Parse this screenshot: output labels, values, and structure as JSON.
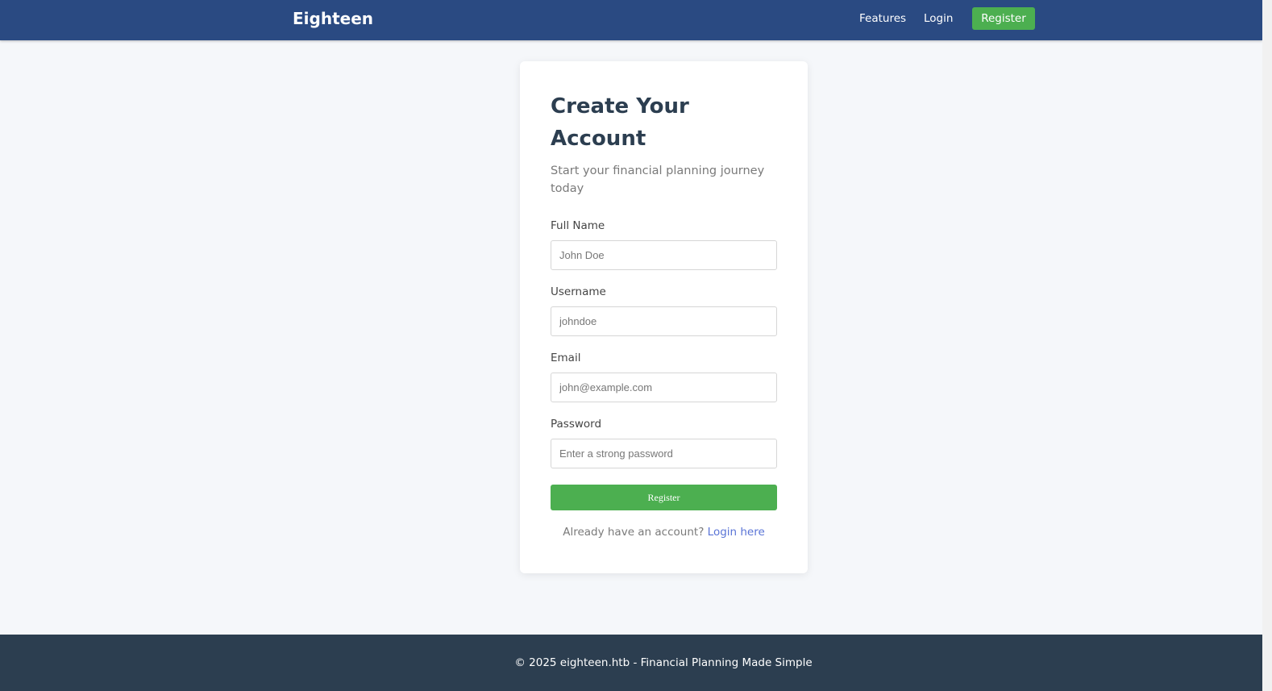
{
  "navbar": {
    "brand": "Eighteen",
    "links": {
      "features": "Features",
      "login": "Login",
      "register": "Register"
    }
  },
  "form": {
    "title": "Create Your Account",
    "subtitle": "Start your financial planning journey today",
    "fields": {
      "full_name": {
        "label": "Full Name",
        "placeholder": "John Doe",
        "value": ""
      },
      "username": {
        "label": "Username",
        "placeholder": "johndoe",
        "value": ""
      },
      "email": {
        "label": "Email",
        "placeholder": "john@example.com",
        "value": ""
      },
      "password": {
        "label": "Password",
        "placeholder": "Enter a strong password",
        "value": ""
      }
    },
    "submit_label": "Register",
    "login_prompt": "Already have an account?",
    "login_link": "Login here"
  },
  "footer": {
    "text": "© 2025 eighteen.htb - Financial Planning Made Simple"
  },
  "colors": {
    "navbar": "#2a4a82",
    "accent": "#4caf50",
    "link": "#5a74d6",
    "footer": "#2c3e50"
  }
}
